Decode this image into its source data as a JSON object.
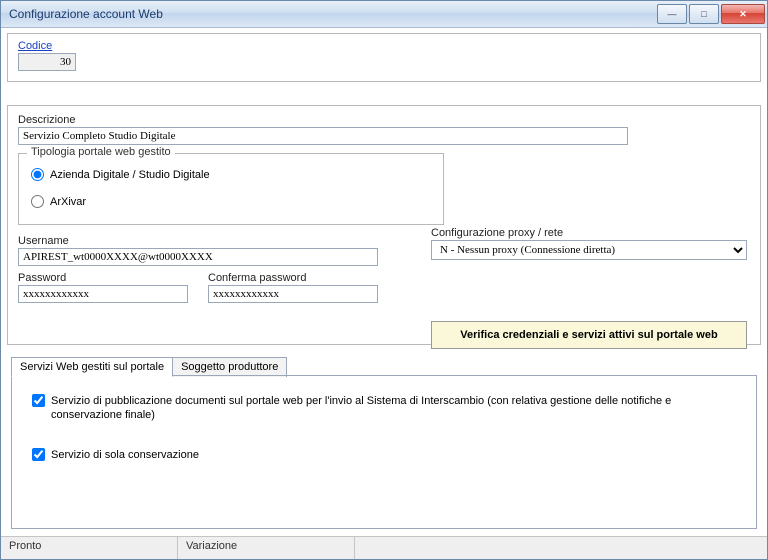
{
  "window": {
    "title": "Configurazione account Web"
  },
  "code": {
    "label": "Codice",
    "value": "30"
  },
  "description": {
    "label": "Descrizione",
    "value": "Servizio Completo Studio Digitale"
  },
  "portalType": {
    "legend": "Tipologia portale web gestito",
    "options": [
      {
        "label": "Azienda Digitale / Studio Digitale",
        "selected": true
      },
      {
        "label": "ArXivar",
        "selected": false
      }
    ]
  },
  "proxy": {
    "label": "Configurazione proxy / rete",
    "selected": "N - Nessun proxy (Connessione diretta)"
  },
  "credentials": {
    "username_label": "Username",
    "username_value": "APIREST_wt0000XXXX@wt0000XXXX",
    "password_label": "Password",
    "password_value": "xxxxxxxxxxxx",
    "confirm_label": "Conferma password",
    "confirm_value": "xxxxxxxxxxxx"
  },
  "verify_button": "Verifica credenziali e servizi attivi sul portale web",
  "tabs": [
    {
      "label": "Servizi Web gestiti sul portale",
      "active": true
    },
    {
      "label": "Soggetto produttore",
      "active": false
    }
  ],
  "services": {
    "pub_label": "Servizio di pubblicazione documenti sul portale web per l'invio al Sistema di Interscambio (con relativa gestione delle notifiche e conservazione finale)",
    "pub_checked": true,
    "cons_label": "Servizio di sola conservazione",
    "cons_checked": true
  },
  "status": {
    "left": "Pronto",
    "mid": "Variazione"
  }
}
